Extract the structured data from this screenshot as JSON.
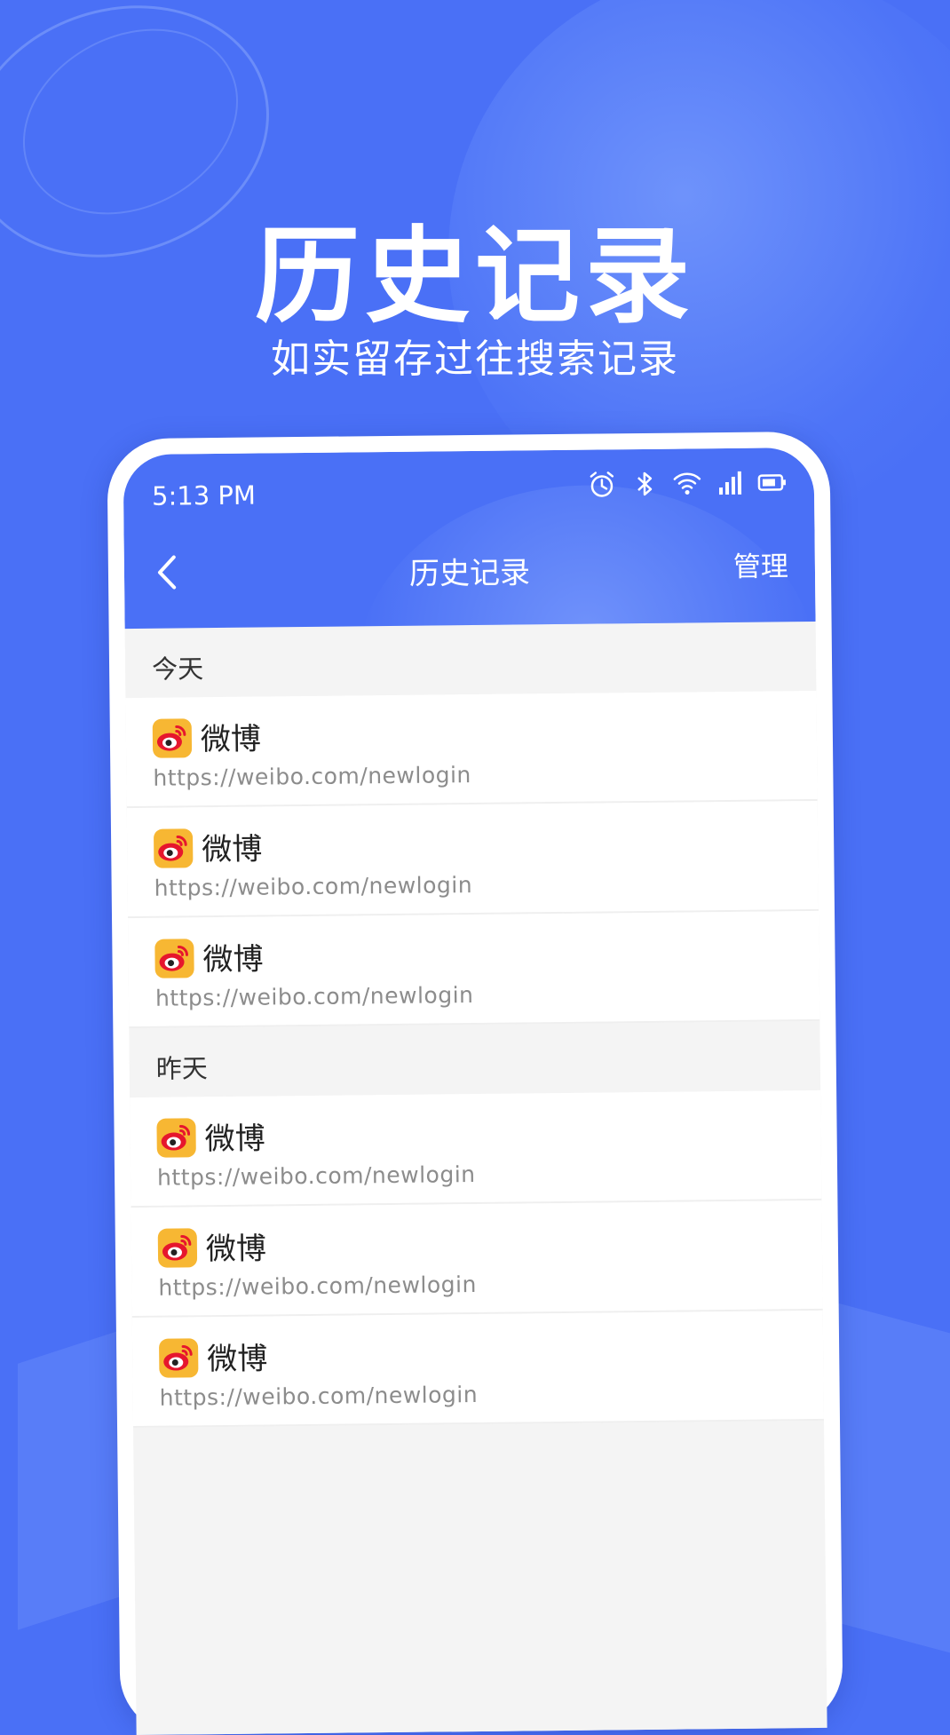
{
  "promo": {
    "title": "历史记录",
    "subtitle": "如实留存过往搜索记录"
  },
  "status_bar": {
    "time": "5:13 PM",
    "icons": [
      "alarm-icon",
      "bluetooth-icon",
      "wifi-icon",
      "signal-icon",
      "battery-icon"
    ]
  },
  "app_bar": {
    "title": "历史记录",
    "back_icon": "back-icon",
    "manage_label": "管理"
  },
  "sections": [
    {
      "header": "今天",
      "items": [
        {
          "name": "微博",
          "url": "https://weibo.com/newlogin",
          "icon": "weibo-icon"
        },
        {
          "name": "微博",
          "url": "https://weibo.com/newlogin",
          "icon": "weibo-icon"
        },
        {
          "name": "微博",
          "url": "https://weibo.com/newlogin",
          "icon": "weibo-icon"
        }
      ]
    },
    {
      "header": "昨天",
      "items": [
        {
          "name": "微博",
          "url": "https://weibo.com/newlogin",
          "icon": "weibo-icon"
        },
        {
          "name": "微博",
          "url": "https://weibo.com/newlogin",
          "icon": "weibo-icon"
        },
        {
          "name": "微博",
          "url": "https://weibo.com/newlogin",
          "icon": "weibo-icon"
        }
      ]
    }
  ],
  "colors": {
    "background": "#4a70f6",
    "weibo_yellow": "#f7b733",
    "weibo_red": "#e6162d"
  }
}
